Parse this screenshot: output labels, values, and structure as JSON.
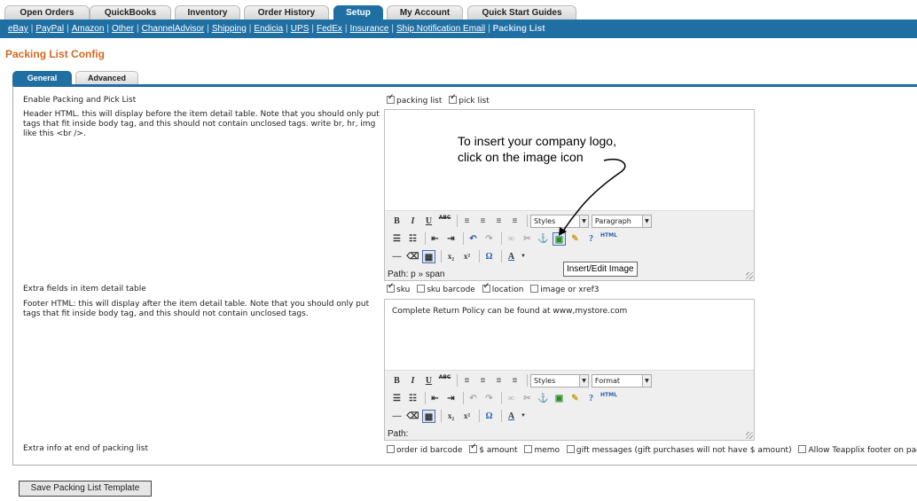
{
  "top_tabs": [
    {
      "label": "Open Orders"
    },
    {
      "label": "QuickBooks"
    },
    {
      "label": "Inventory"
    },
    {
      "label": "Order History"
    },
    {
      "label": "Setup",
      "active": true
    },
    {
      "label": "My Account"
    },
    {
      "label": "Quick Start Guides"
    }
  ],
  "subnav": {
    "links": [
      "eBay",
      "PayPal",
      "Amazon",
      "Other",
      "ChannelAdvisor",
      "Shipping",
      "Endicia",
      "UPS",
      "FedEx",
      "Insurance",
      "Ship Notification Email"
    ],
    "current": "Packing List"
  },
  "page_title": "Packing List Config",
  "sub_tabs": [
    "General",
    "Advanced"
  ],
  "form": {
    "enable_label": "Enable Packing and Pick List",
    "packing_list_label": "packing list",
    "pick_list_label": "pick list",
    "header_help": "Header HTML. this will display before the item detail table. Note that you should only put tags that fit inside body tag, and this should not contain unclosed tags. write br, hr, img like this <br />.",
    "extra_fields_label": "Extra fields in item detail table",
    "extra_fields": [
      {
        "label": "sku",
        "checked": true
      },
      {
        "label": "sku barcode",
        "checked": false
      },
      {
        "label": "location",
        "checked": true
      },
      {
        "label": "image or xref3",
        "checked": false
      }
    ],
    "footer_help": "Footer HTML: this will display after the item detail table. Note that you should only put tags that fit inside body tag, and this should not contain unclosed tags.",
    "footer_content": "Complete Return Policy can be found at www,mystore.com",
    "extra_info_label": "Extra info at end of packing list",
    "extra_info": [
      {
        "label": "order id barcode",
        "checked": false
      },
      {
        "label": "$ amount",
        "checked": true
      },
      {
        "label": "memo",
        "checked": false
      },
      {
        "label": "gift messages (gift purchases will not have $ amount)",
        "checked": false
      },
      {
        "label": "Allow Teapplix footer on page bottom",
        "checked": false
      }
    ]
  },
  "header_editor": {
    "styles": "Styles",
    "format": "Paragraph",
    "path": "Path: p » span"
  },
  "footer_editor": {
    "styles": "Styles",
    "format": "Format",
    "path": "Path:"
  },
  "toolbar_text": {
    "html_label": "HTML",
    "abc": "ABC"
  },
  "callout_line1": "To insert your company logo,",
  "callout_line2": "click on the image icon",
  "tooltip": "Insert/Edit Image",
  "save_button": "Save Packing List Template"
}
